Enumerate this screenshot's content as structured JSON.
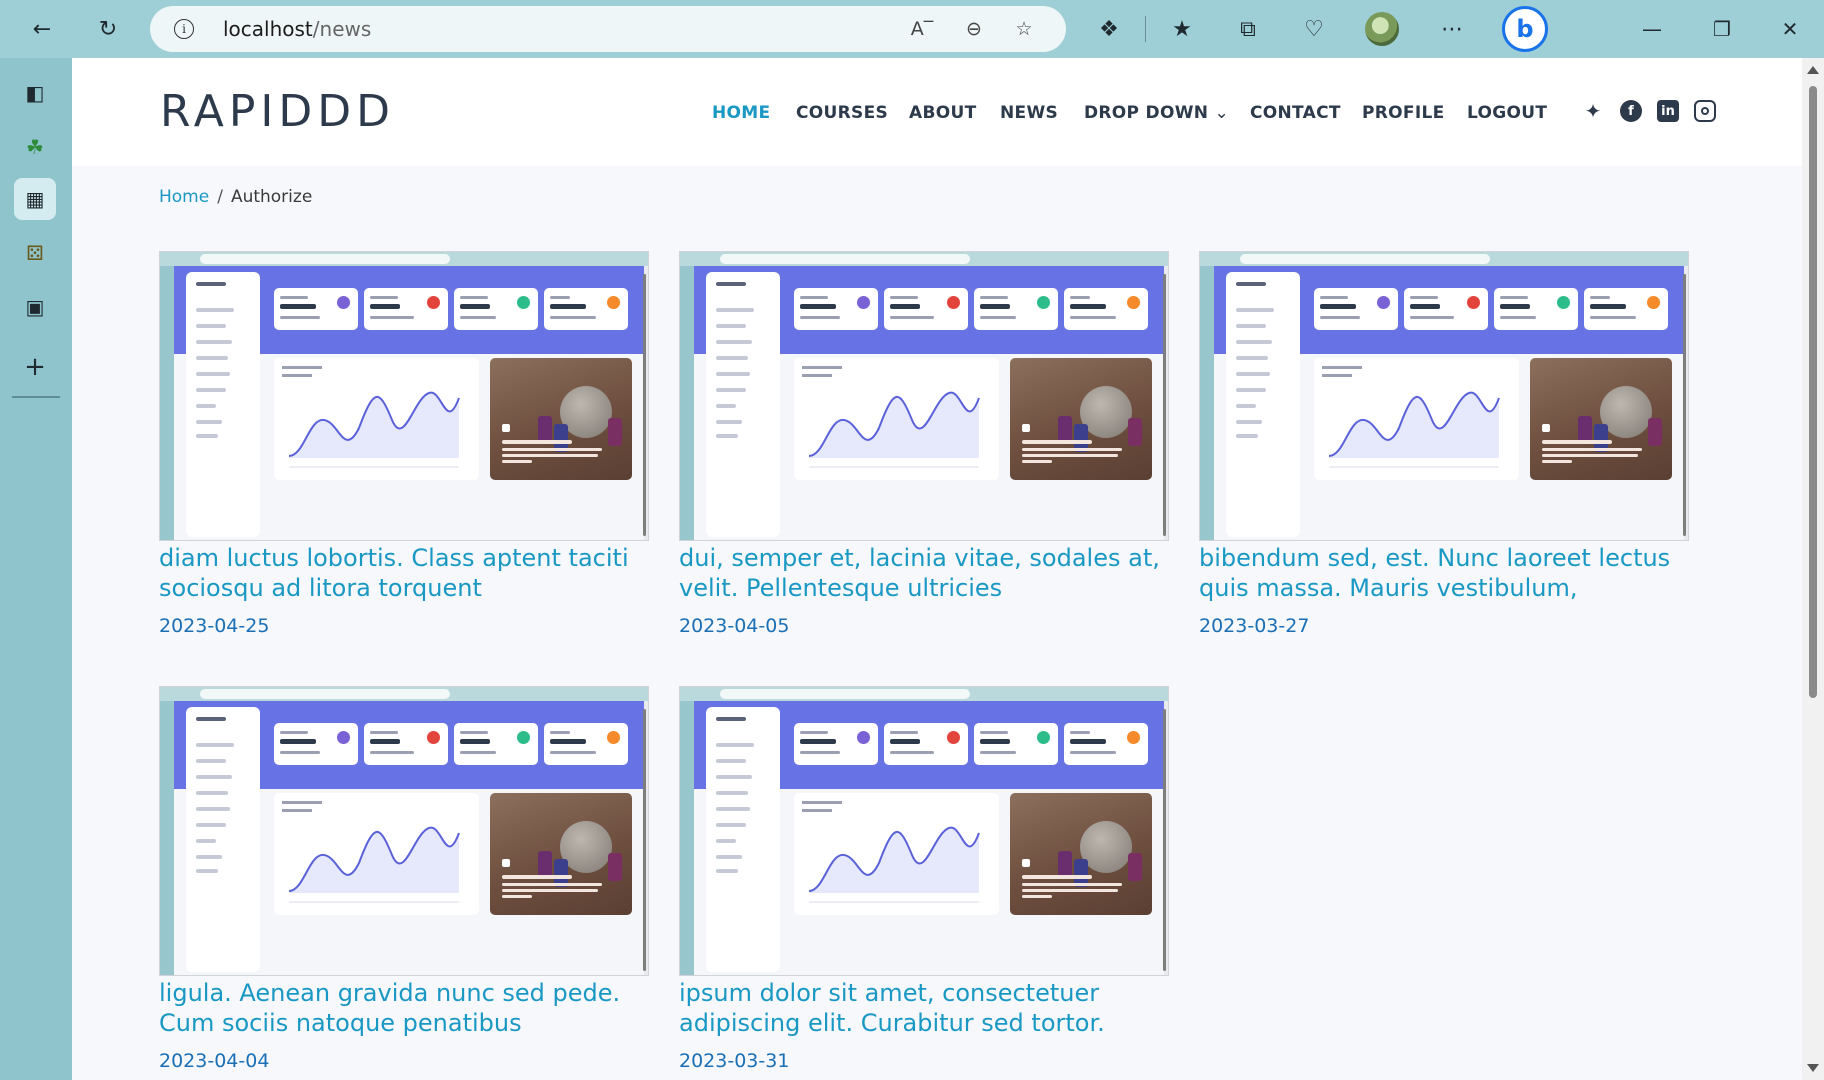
{
  "browser": {
    "url_host": "localhost",
    "url_path": "/news"
  },
  "site": {
    "brand": "RAPIDDD",
    "nav": [
      {
        "label": "HOME",
        "active": true
      },
      {
        "label": "COURSES",
        "active": false
      },
      {
        "label": "ABOUT",
        "active": false
      },
      {
        "label": "NEWS",
        "active": false
      },
      {
        "label": "DROP DOWN",
        "active": false
      },
      {
        "label": "CONTACT",
        "active": false
      },
      {
        "label": "PROFILE",
        "active": false
      },
      {
        "label": "LOGOUT",
        "active": false
      }
    ],
    "social": [
      "twitter-icon",
      "facebook-icon",
      "linkedin-icon",
      "instagram-icon"
    ]
  },
  "breadcrumb": {
    "home": "Home",
    "separator": "/",
    "current": "Authorize"
  },
  "news": [
    {
      "title": "diam luctus lobortis. Class aptent taciti sociosqu ad litora torquent",
      "date": "2023-04-25"
    },
    {
      "title": "dui, semper et, lacinia vitae, sodales at, velit. Pellentesque ultricies",
      "date": "2023-04-05"
    },
    {
      "title": "bibendum sed, est. Nunc laoreet lectus quis massa. Mauris vestibulum,",
      "date": "2023-03-27"
    },
    {
      "title": "ligula. Aenean gravida nunc sed pede. Cum sociis natoque penatibus",
      "date": "2023-04-04"
    },
    {
      "title": "ipsum dolor sit amet, consectetuer adipiscing elit. Curabitur sed tortor.",
      "date": "2023-03-31"
    }
  ],
  "colors": {
    "accent": "#1a98c4",
    "date": "#1a6fb5",
    "brand": "#2d3a4b",
    "browser_bar": "#9fcfd6",
    "sidebar": "#8fc4cc"
  }
}
